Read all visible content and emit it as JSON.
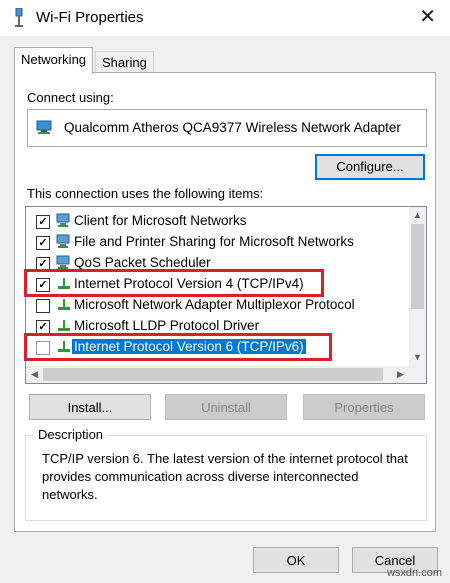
{
  "window": {
    "title": "Wi-Fi Properties",
    "close_glyph": "✕"
  },
  "tabs": [
    {
      "label": "Networking",
      "active": true
    },
    {
      "label": "Sharing",
      "active": false
    }
  ],
  "connect_using": {
    "label": "Connect using:",
    "adapter": "Qualcomm Atheros QCA9377 Wireless Network Adapter",
    "configure_label": "Configure..."
  },
  "items_section": {
    "label": "This connection uses the following items:",
    "items": [
      {
        "label": "Client for Microsoft Networks",
        "checked": true,
        "icon": "network-client-icon"
      },
      {
        "label": "File and Printer Sharing for Microsoft Networks",
        "checked": true,
        "icon": "network-service-icon"
      },
      {
        "label": "QoS Packet Scheduler",
        "checked": true,
        "icon": "network-service-icon"
      },
      {
        "label": "Internet Protocol Version 4 (TCP/IPv4)",
        "checked": true,
        "icon": "protocol-icon"
      },
      {
        "label": "Microsoft Network Adapter Multiplexor Protocol",
        "checked": false,
        "icon": "protocol-icon"
      },
      {
        "label": "Microsoft LLDP Protocol Driver",
        "checked": true,
        "icon": "protocol-icon"
      },
      {
        "label": "Internet Protocol Version 6 (TCP/IPv6)",
        "checked": false,
        "icon": "protocol-icon",
        "selected": true
      }
    ],
    "check_glyph": "✓"
  },
  "buttons": {
    "install": "Install...",
    "uninstall": "Uninstall",
    "properties": "Properties",
    "ok": "OK",
    "cancel": "Cancel"
  },
  "description": {
    "legend": "Description",
    "text": "TCP/IP version 6. The latest version of the internet protocol that provides communication across diverse interconnected networks."
  },
  "watermark": "wsxdn.com",
  "colors": {
    "accent": "#0078d7",
    "highlight_box": "#d9202a"
  }
}
